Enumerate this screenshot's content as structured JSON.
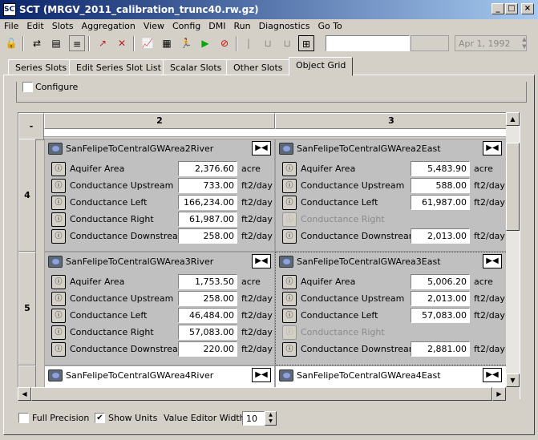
{
  "window": {
    "title": "SCT  (MRGV_2011_calibration_trunc40.rw.gz)",
    "app_icon": "SCT",
    "minimize": "_",
    "maximize": "□",
    "close": "×"
  },
  "menu": [
    "File",
    "Edit",
    "Slots",
    "Aggregation",
    "View",
    "Config",
    "DMI",
    "Run",
    "Diagnostics",
    "Go To"
  ],
  "toolbar": {
    "search_value": "",
    "date": "Apr 1, 1992"
  },
  "tabs": [
    "Series Slots",
    "Edit Series Slot List",
    "Scalar Slots",
    "Other Slots",
    "Object Grid"
  ],
  "active_tab": "Object Grid",
  "configure_label": "Configure",
  "grid": {
    "corner": "-",
    "columns": [
      "2",
      "3"
    ],
    "rows": [
      "4",
      "5"
    ],
    "cells": [
      {
        "name": "SanFelipeToCentralGWArea2River",
        "slots": [
          {
            "label": "Aquifer Area",
            "value": "2,376.60",
            "unit": "acre"
          },
          {
            "label": "Conductance Upstream",
            "value": "733.00",
            "unit": "ft2/day"
          },
          {
            "label": "Conductance Left",
            "value": "166,234.00",
            "unit": "ft2/day"
          },
          {
            "label": "Conductance Right",
            "value": "61,987.00",
            "unit": "ft2/day"
          },
          {
            "label": "Conductance Downstream",
            "value": "258.00",
            "unit": "ft2/day"
          }
        ]
      },
      {
        "name": "SanFelipeToCentralGWArea2East",
        "slots": [
          {
            "label": "Aquifer Area",
            "value": "5,483.90",
            "unit": "acre"
          },
          {
            "label": "Conductance Upstream",
            "value": "588.00",
            "unit": "ft2/day"
          },
          {
            "label": "Conductance Left",
            "value": "61,987.00",
            "unit": "ft2/day"
          },
          {
            "label": "Conductance Right",
            "value": "",
            "unit": ""
          },
          {
            "label": "Conductance Downstream",
            "value": "2,013.00",
            "unit": "ft2/day"
          }
        ]
      },
      {
        "name": "SanFelipeToCentralGWArea3River",
        "slots": [
          {
            "label": "Aquifer Area",
            "value": "1,753.50",
            "unit": "acre"
          },
          {
            "label": "Conductance Upstream",
            "value": "258.00",
            "unit": "ft2/day"
          },
          {
            "label": "Conductance Left",
            "value": "46,484.00",
            "unit": "ft2/day"
          },
          {
            "label": "Conductance Right",
            "value": "57,083.00",
            "unit": "ft2/day"
          },
          {
            "label": "Conductance Downstream",
            "value": "220.00",
            "unit": "ft2/day"
          }
        ]
      },
      {
        "name": "SanFelipeToCentralGWArea3East",
        "slots": [
          {
            "label": "Aquifer Area",
            "value": "5,006.20",
            "unit": "acre"
          },
          {
            "label": "Conductance Upstream",
            "value": "2,013.00",
            "unit": "ft2/day"
          },
          {
            "label": "Conductance Left",
            "value": "57,083.00",
            "unit": "ft2/day"
          },
          {
            "label": "Conductance Right",
            "value": "",
            "unit": ""
          },
          {
            "label": "Conductance Downstream",
            "value": "2,881.00",
            "unit": "ft2/day"
          }
        ]
      },
      {
        "name": "SanFelipeToCentralGWArea4River",
        "slots": []
      },
      {
        "name": "SanFelipeToCentralGWArea4East",
        "slots": []
      }
    ]
  },
  "bottom": {
    "full_precision": "Full Precision",
    "show_units": "Show Units",
    "value_editor_width_label": "Value Editor Width:",
    "value_editor_width": "10"
  }
}
